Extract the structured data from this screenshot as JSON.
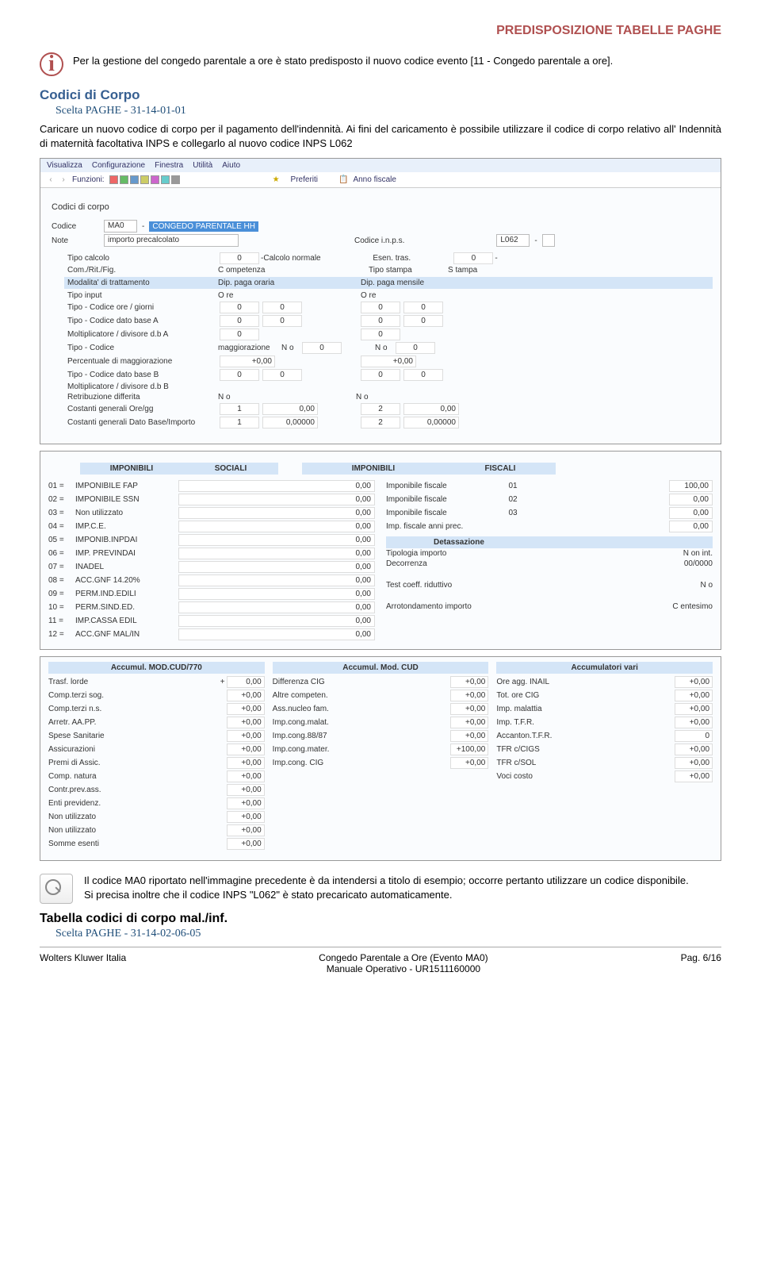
{
  "header": {
    "title": "PREDISPOSIZIONE TABELLE PAGHE"
  },
  "info": {
    "icon_glyph": "i",
    "text": "Per la gestione del congedo parentale a ore è stato predisposto il nuovo codice evento [11 - Congedo parentale a ore]."
  },
  "sec1": {
    "title": "Codici di Corpo",
    "scelta": "Scelta PAGHE - 31-14-01-01",
    "para": "Caricare un nuovo codice di corpo per il pagamento dell'indennità. Ai fini del caricamento è possibile utilizzare il codice di corpo relativo all' Indennità di maternità facoltativa INPS e collegarlo al nuovo codice INPS L062"
  },
  "app": {
    "menu": [
      "Visualizza",
      "Configurazione",
      "Finestra",
      "Utilità",
      "Aiuto"
    ],
    "funzioni": "Funzioni:",
    "preferiti": "Preferiti",
    "anno": "Anno fiscale",
    "title": "Codici di corpo",
    "labels": {
      "codice": "Codice",
      "note": "Note",
      "codice_inps": "Codice i.n.p.s.",
      "tipo_calcolo": "Tipo calcolo",
      "calcolo_normale": "Calcolo normale",
      "esen": "Esen. tras.",
      "com": "Com./Rit./Fig.",
      "competenza": "C ompetenza",
      "tipo_stampa": "Tipo stampa",
      "stampa": "S tampa",
      "mod": "Modalita' di trattamento",
      "dip_oraria": "Dip. paga oraria",
      "dip_mensile": "Dip. paga mensile",
      "tipo_input": "Tipo input",
      "ore": "O re",
      "r1": "Tipo - Codice ore / giorni",
      "r2": "Tipo - Codice dato base A",
      "r3": "Moltiplicatore / divisore d.b A",
      "r4": "Tipo - Codice",
      "magg": "maggiorazione",
      "no": "N o",
      "r5": "Percentuale di maggiorazione",
      "r6": "Tipo - Codice dato base B",
      "r7": "Moltiplicatore / divisore d.b B",
      "r8": "Retribuzione differita",
      "r9": "Costanti generali Ore/gg",
      "r10": "Costanti generali Dato Base/Importo"
    },
    "values": {
      "codice": "MA0",
      "codice_desc": "CONGEDO PARENTALE HH",
      "note": "importo precalcolato",
      "inps": "L062",
      "tipo_calcolo_n": "0",
      "esen_n": "0",
      "zero": "0",
      "plus000": "+0,00",
      "v000": "0,00",
      "v00000": "0,00000",
      "v1": "1",
      "v2": "2"
    },
    "imponibili": {
      "h1": "IMPONIBILI",
      "h2": "SOCIALI",
      "h3": "IMPONIBILI",
      "h4": "FISCALI",
      "left": [
        {
          "k": "01 =",
          "l": "IMPONIBILE FAP",
          "v": "0,00"
        },
        {
          "k": "02 =",
          "l": "IMPONIBILE SSN",
          "v": "0,00"
        },
        {
          "k": "03 =",
          "l": "Non utilizzato",
          "v": "0,00"
        },
        {
          "k": "04 =",
          "l": "IMP.C.E.",
          "v": "0,00"
        },
        {
          "k": "05 =",
          "l": "IMPONIB.INPDAI",
          "v": "0,00"
        },
        {
          "k": "06 =",
          "l": "IMP. PREVINDAI",
          "v": "0,00"
        },
        {
          "k": "07 =",
          "l": "INADEL",
          "v": "0,00"
        },
        {
          "k": "08 =",
          "l": "ACC.GNF 14.20%",
          "v": "0,00"
        },
        {
          "k": "09 =",
          "l": "PERM.IND.EDILI",
          "v": "0,00"
        },
        {
          "k": "10 =",
          "l": "PERM.SIND.ED.",
          "v": "0,00"
        },
        {
          "k": "11 =",
          "l": "IMP.CASSA EDIL",
          "v": "0,00"
        },
        {
          "k": "12 =",
          "l": "ACC.GNF MAL/IN",
          "v": "0,00"
        }
      ],
      "right_top": [
        {
          "l": "Imponibile fiscale",
          "k": "01",
          "v": "100,00"
        },
        {
          "l": "Imponibile fiscale",
          "k": "02",
          "v": "0,00"
        },
        {
          "l": "Imponibile fiscale",
          "k": "03",
          "v": "0,00"
        },
        {
          "l": "Imp. fiscale anni prec.",
          "k": "",
          "v": "0,00"
        }
      ],
      "detass": "Detassazione",
      "tipologia": "Tipologia importo",
      "tipologia_v": "N on int.",
      "decorrenza": "Decorrenza",
      "decorrenza_v": "00/0000",
      "test": "Test coeff. riduttivo",
      "test_v": "N o",
      "arrot": "Arrotondamento importo",
      "arrot_v": "C entesimo"
    },
    "accum": {
      "h1": "Accumul. MOD.CUD/770",
      "h2": "Accumul. Mod. CUD",
      "h3": "Accumulatori vari",
      "c1": [
        {
          "l": "Trasf. lorde",
          "s": "+",
          "v": "0,00"
        },
        {
          "l": "Comp.terzi sog.",
          "s": "",
          "v": "+0,00"
        },
        {
          "l": "Comp.terzi n.s.",
          "s": "",
          "v": "+0,00"
        },
        {
          "l": "Arretr. AA.PP.",
          "s": "",
          "v": "+0,00"
        },
        {
          "l": "Spese Sanitarie",
          "s": "",
          "v": "+0,00"
        },
        {
          "l": "Assicurazioni",
          "s": "",
          "v": "+0,00"
        },
        {
          "l": "Premi di Assic.",
          "s": "",
          "v": "+0,00"
        },
        {
          "l": "Comp. natura",
          "s": "",
          "v": "+0,00"
        },
        {
          "l": "Contr.prev.ass.",
          "s": "",
          "v": "+0,00"
        },
        {
          "l": "Enti previdenz.",
          "s": "",
          "v": "+0,00"
        },
        {
          "l": "Non utilizzato",
          "s": "",
          "v": "+0,00"
        },
        {
          "l": "Non utilizzato",
          "s": "",
          "v": "+0,00"
        },
        {
          "l": "Somme esenti",
          "s": "",
          "v": "+0,00"
        }
      ],
      "c2": [
        {
          "l": "Differenza CIG",
          "v": "+0,00"
        },
        {
          "l": "Altre competen.",
          "v": "+0,00"
        },
        {
          "l": "Ass.nucleo fam.",
          "v": "+0,00"
        },
        {
          "l": "Imp.cong.malat.",
          "v": "+0,00"
        },
        {
          "l": "Imp.cong.88/87",
          "v": "+0,00"
        },
        {
          "l": "Imp.cong.mater.",
          "v": "+100,00"
        },
        {
          "l": "Imp.cong. CIG",
          "v": "+0,00"
        }
      ],
      "c3": [
        {
          "l": "Ore agg. INAIL",
          "v": "+0,00"
        },
        {
          "l": "Tot. ore CIG",
          "v": "+0,00"
        },
        {
          "l": "Imp. malattia",
          "v": "+0,00"
        },
        {
          "l": "Imp. T.F.R.",
          "v": "+0,00"
        },
        {
          "l": "Accanton.T.F.R.",
          "v": "0"
        },
        {
          "l": "TFR c/CIGS",
          "v": "+0,00"
        },
        {
          "l": "TFR c/SOL",
          "v": "+0,00"
        },
        {
          "l": "Voci costo",
          "v": "+0,00"
        }
      ]
    }
  },
  "note": {
    "text": "Il codice MA0 riportato nell'immagine precedente è da intendersi a titolo di esempio; occorre pertanto utilizzare un codice disponibile.\nSi precisa inoltre che il codice INPS \"L062\" è stato precaricato automaticamente."
  },
  "sec2": {
    "title": "Tabella codici di corpo mal./inf.",
    "scelta": "Scelta PAGHE - 31-14-02-06-05"
  },
  "footer": {
    "left": "Wolters Kluwer Italia",
    "mid1": "Congedo Parentale a Ore (Evento MA0)",
    "mid2": "Manuale Operativo - UR1511160000",
    "right": "Pag.  6/16"
  }
}
